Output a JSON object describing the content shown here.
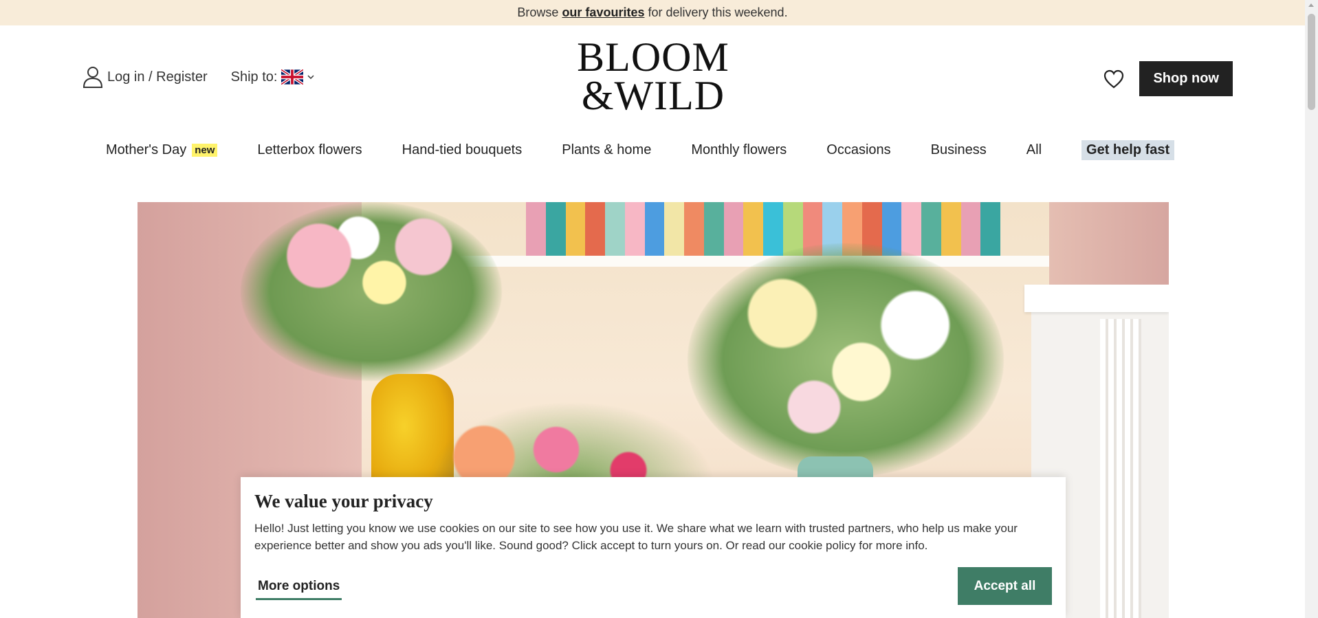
{
  "promo": {
    "before": "Browse",
    "link": "our favourites",
    "after": "for delivery this weekend."
  },
  "header": {
    "login_label": "Log in / Register",
    "ship_label": "Ship to:",
    "logo_line1": "BLOOM",
    "logo_line2": "&WILD",
    "shop_now": "Shop now"
  },
  "nav": {
    "items": [
      {
        "label": "Mother's Day",
        "badge": "new"
      },
      {
        "label": "Letterbox flowers"
      },
      {
        "label": "Hand-tied bouquets"
      },
      {
        "label": "Plants & home"
      },
      {
        "label": "Monthly flowers"
      },
      {
        "label": "Occasions"
      },
      {
        "label": "Business"
      },
      {
        "label": "All"
      },
      {
        "label": "Get help fast"
      }
    ]
  },
  "cookie": {
    "title": "We value your privacy",
    "body": "Hello! Just letting you know we use cookies on our site to see how you use it. We share what we learn with trusted partners, who help us make your experience better and show you ads you'll like. Sound good? Click accept to turn yours on. Or read our cookie policy for more info.",
    "more_options": "More options",
    "accept_all": "Accept all"
  },
  "colors": {
    "promo_bg": "#f8ecd9",
    "accent_green": "#3f7d66",
    "shop_now_bg": "#222222",
    "new_badge": "#fff36b",
    "help_bg": "#d6dfe7"
  },
  "icons": [
    "user-icon",
    "uk-flag-icon",
    "chevron-down-icon",
    "heart-icon",
    "rose-logo-icon"
  ]
}
